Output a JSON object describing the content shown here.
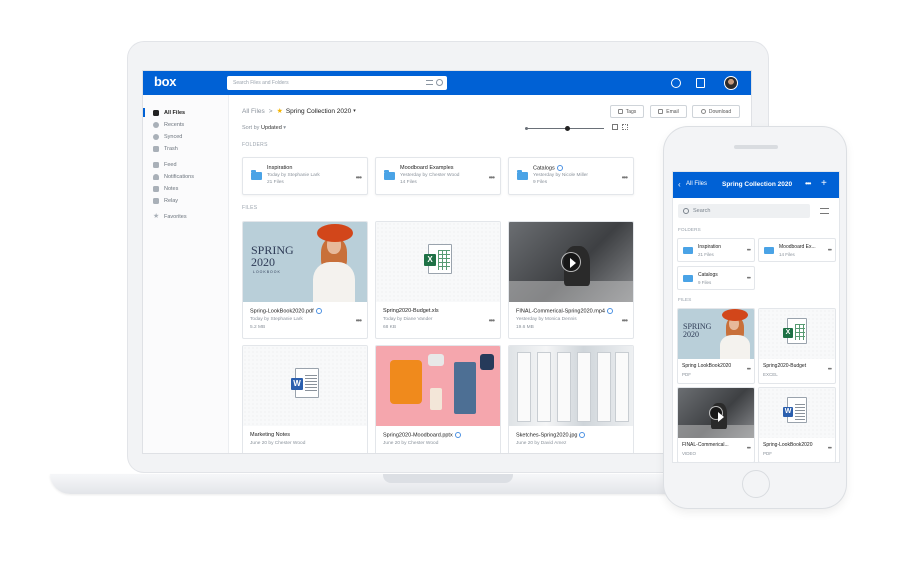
{
  "desktop": {
    "logo": "box",
    "search_placeholder": "Search Files and Folders",
    "sidebar": {
      "items": [
        {
          "label": "All Files",
          "icon": "folder-icon",
          "active": true
        },
        {
          "label": "Recents",
          "icon": "clock-icon"
        },
        {
          "label": "Synced",
          "icon": "sync-icon"
        },
        {
          "label": "Trash",
          "icon": "trash-icon"
        },
        {
          "label": "Feed",
          "icon": "feed-icon"
        },
        {
          "label": "Notifications",
          "icon": "bell-icon"
        },
        {
          "label": "Notes",
          "icon": "notes-icon"
        },
        {
          "label": "Relay",
          "icon": "relay-icon"
        },
        {
          "label": "Favorites",
          "icon": "star-icon"
        }
      ]
    },
    "breadcrumb": {
      "root": "All Files",
      "separator": ">",
      "current": "Spring Collection 2020",
      "caret": "▾"
    },
    "actions": {
      "tags": "Tags",
      "email": "Email",
      "download": "Download"
    },
    "sort": {
      "label": "Sort by",
      "value": "Updated",
      "caret": "▾"
    },
    "sections": {
      "folders": "FOLDERS",
      "files": "FILES"
    },
    "folders": [
      {
        "name": "Inspiration",
        "meta": "Today by Stephanie Lark",
        "count": "21 Files"
      },
      {
        "name": "Moodboard Examples",
        "meta": "Yesterday by Chester Wood",
        "count": "14 Files"
      },
      {
        "name": "Catalogs",
        "meta": "Yesterday by Nicole Miller",
        "count": "9 Files"
      }
    ],
    "files": [
      {
        "name": "Spring-LookBook2020.pdf",
        "meta": "Today by Stephanie Lark",
        "size": "5.2 MB",
        "thumb": "lookbook"
      },
      {
        "name": "Spring2020-Budget.xls",
        "meta": "Today by Diane Vander",
        "size": "68 KB",
        "thumb": "excel"
      },
      {
        "name": "FINAL-Commerical-Spring2020.mp4",
        "meta": "Yesterday by Monica Dennis",
        "size": "19.6 MB",
        "thumb": "video"
      },
      {
        "name": "Marketing Notes",
        "meta": "June 20 by Chester Wood",
        "size": "",
        "thumb": "word"
      },
      {
        "name": "Spring2020-Moodboard.pptx",
        "meta": "June 20 by Chester Wood",
        "size": "",
        "thumb": "moodboard"
      },
      {
        "name": "Sketches-Spring2020.jpg",
        "meta": "June 20 by David Amez",
        "size": "",
        "thumb": "sketches"
      }
    ],
    "lookbook_text": {
      "line1": "SPRING",
      "line2": "2020",
      "line3": "LOOKBOOK"
    }
  },
  "mobile": {
    "back_label": "All Files",
    "title": "Spring Collection 2020",
    "search_placeholder": "Search",
    "sections": {
      "folders": "FOLDERS",
      "files": "FILES"
    },
    "folders": [
      {
        "name": "Inspiration",
        "count": "21 Files"
      },
      {
        "name": "Moodboard Ex...",
        "count": "14 Files"
      },
      {
        "name": "Catalogs",
        "count": "9 Files"
      }
    ],
    "files": [
      {
        "name": "Spring LookBook2020",
        "type": "PDF"
      },
      {
        "name": "Spring2020-Budget",
        "type": "EXCEL"
      },
      {
        "name": "FINAL-Commerical...",
        "type": "VIDEO"
      },
      {
        "name": "Spring-LookBook2020",
        "type": "PDF"
      }
    ]
  },
  "colors": {
    "brand": "#0061d5",
    "folder": "#4aa3e6",
    "excel": "#1e7145",
    "word": "#2b5fae",
    "star": "#f5b400"
  }
}
